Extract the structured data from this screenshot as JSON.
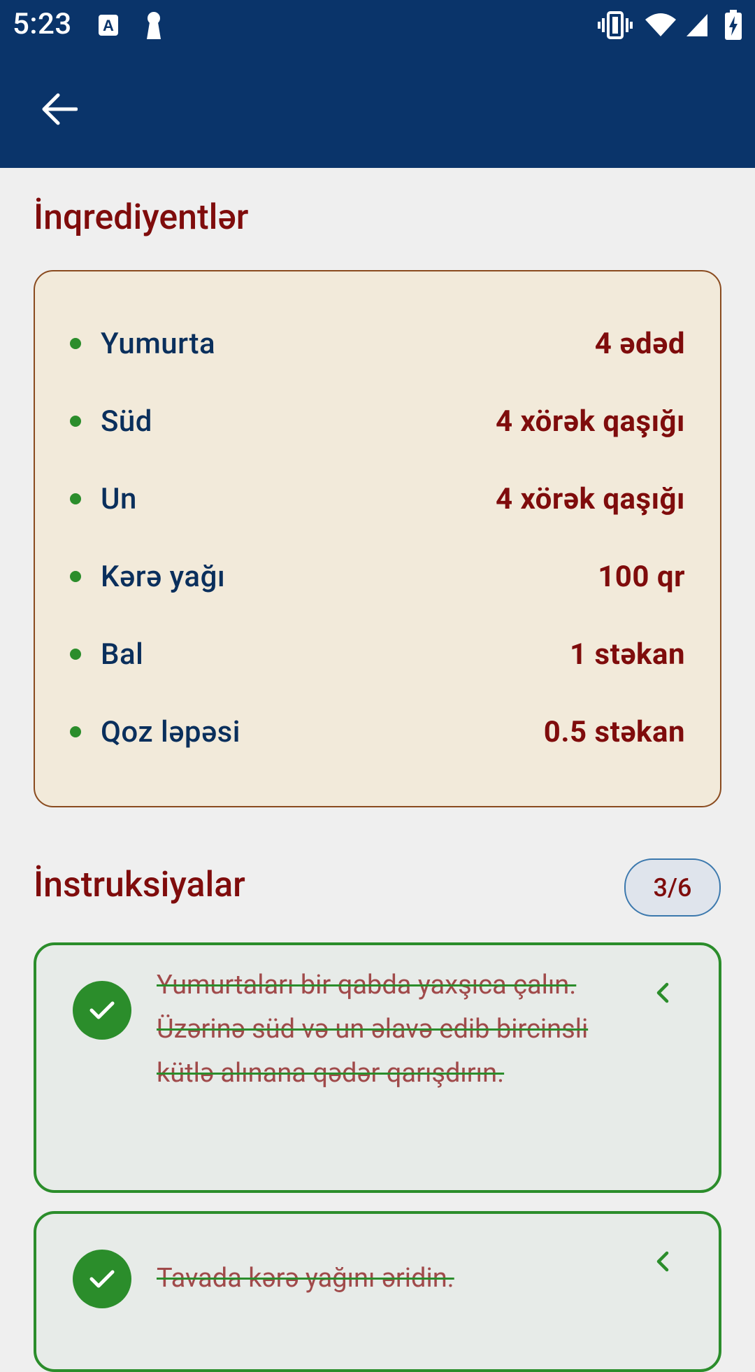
{
  "status_bar": {
    "time": "5:23",
    "icons": [
      "text-a-icon",
      "keyhole-icon",
      "vibrate-icon",
      "wifi-icon",
      "signal-icon",
      "battery-charging-icon"
    ]
  },
  "app_bar": {
    "back_icon": "arrow-back-icon"
  },
  "ingredients": {
    "title": "İnqrediyentlər",
    "items": [
      {
        "name": "Yumurta",
        "amount": "4 ədəd"
      },
      {
        "name": "Süd",
        "amount": "4 xörək qaşığı"
      },
      {
        "name": "Un",
        "amount": "4 xörək qaşığı"
      },
      {
        "name": "Kərə yağı",
        "amount": "100 qr"
      },
      {
        "name": "Bal",
        "amount": "1 stəkan"
      },
      {
        "name": "Qoz ləpəsi",
        "amount": "0.5 stəkan"
      }
    ]
  },
  "instructions": {
    "title": "İnstruksiyalar",
    "progress": "3/6",
    "steps": [
      {
        "text": "Yumurtaları bir qabda yaxşıca çalın. Üzərinə süd və un əlavə edib bircinsli kütlə alınana qədər qarışdırın.",
        "done": true
      },
      {
        "text": "Tavada kərə yağını əridin.",
        "done": true
      }
    ]
  },
  "colors": {
    "primary": "#0a346a",
    "accent": "#7f0c0c",
    "success": "#2b8d2b",
    "card_bg": "#f2eada"
  }
}
